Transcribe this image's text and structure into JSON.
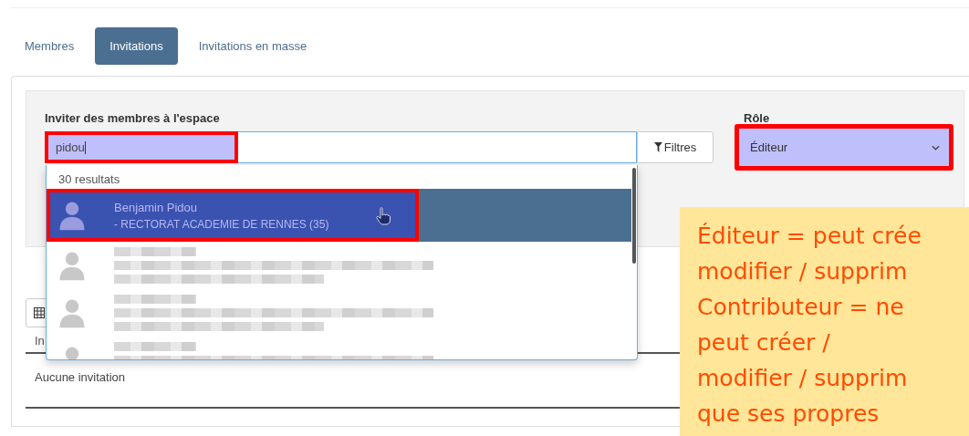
{
  "tabs": [
    {
      "label": "Membres",
      "selected": false
    },
    {
      "label": "Invitations",
      "selected": true
    },
    {
      "label": "Invitations en masse",
      "selected": false
    }
  ],
  "invite": {
    "label": "Inviter des membres à l'espace",
    "value": "pidou",
    "highlighted": true,
    "filters_button": "Filtres"
  },
  "role": {
    "label": "Rôle",
    "value": "Éditeur",
    "highlighted": true
  },
  "results": {
    "count": "30 resultats",
    "items": [
      {
        "kind": "person",
        "name": "Benjamin Pidou",
        "detail": "- RECTORAT ACADEMIE DE RENNES (35)",
        "selected": true,
        "highlighted": true
      },
      {
        "kind": "blurred",
        "selected": false,
        "highlighted": false
      },
      {
        "kind": "blurred",
        "selected": false,
        "highlighted": false
      },
      {
        "kind": "blurred",
        "selected": false,
        "highlighted": false
      }
    ]
  },
  "table": {
    "column_1": "In",
    "empty_message": "Aucune invitation"
  },
  "note": {
    "lines": [
      "Éditeur = peut crée",
      "modifier / supprim",
      "Contributeur = ne",
      "peut créer /",
      "modifier / supprim",
      "que ses propres"
    ]
  }
}
